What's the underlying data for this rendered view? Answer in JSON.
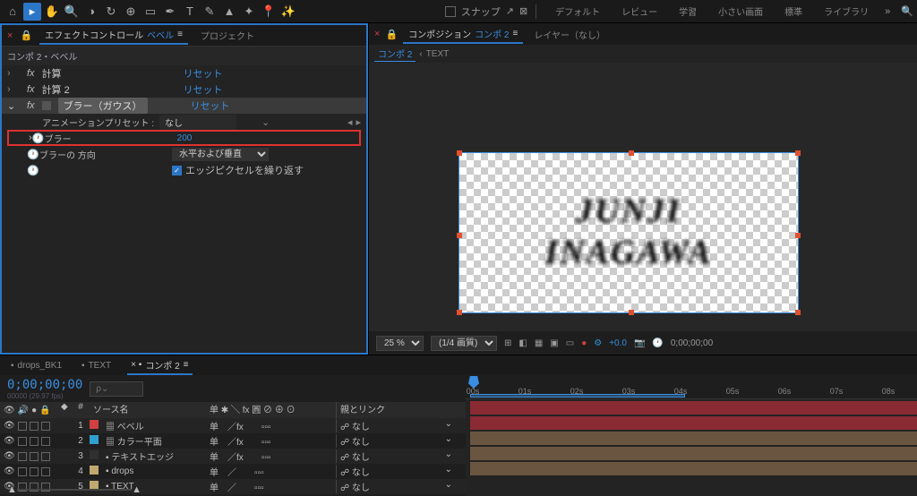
{
  "toolbar": {
    "snap_label": "スナップ"
  },
  "workspaces": [
    "デフォルト",
    "レビュー",
    "学習",
    "小さい画面",
    "標準",
    "ライブラリ"
  ],
  "effect_panel": {
    "tab_effect": "エフェクトコントロール",
    "tab_effect_layer": "ベベル",
    "tab_project": "プロジェクト",
    "breadcrumb": "コンポ 2・ベベル",
    "fx": [
      {
        "name": "計算",
        "reset": "リセット"
      },
      {
        "name": "計算 2",
        "reset": "リセット"
      },
      {
        "name": "ブラー（ガウス）",
        "reset": "リセット",
        "selected": true
      }
    ],
    "preset_label": "アニメーションプリセット :",
    "preset_value": "なし",
    "props": {
      "blur_label": "ブラー",
      "blur_value": "200",
      "dir_label": "ブラーの 方向",
      "dir_value": "水平および垂直",
      "edge_label": "エッジピクセルを繰り返す"
    }
  },
  "comp_panel": {
    "tab_comp": "コンポジション",
    "tab_comp_name": "コンポ 2",
    "tab_layer": "レイヤー（なし）",
    "sub_active": "コンポ 2",
    "sub_text": "TEXT",
    "canvas_line1": "JUNJI",
    "canvas_line2": "INAGAWA"
  },
  "viewer": {
    "zoom": "25 %",
    "quality": "(1/4 画質)",
    "exposure": "+0.0",
    "time": "0;00;00;00"
  },
  "timeline": {
    "tabs": [
      "drops_BK1",
      "TEXT",
      "コンポ 2"
    ],
    "timecode": "0;00;00;00",
    "sub_time": "00000 (29.97 fps)",
    "search_placeholder": "ρ⌄",
    "col_num": "#",
    "col_source": "ソース名",
    "col_switches": "单 ✱ ╲ fx 圓 ⊘ ⊕ ⊙",
    "col_parent": "親とリンク",
    "layers": [
      {
        "n": 1,
        "color": "#d04040",
        "name": "ベベル",
        "sw": "单　／fx",
        "parent": "なし"
      },
      {
        "n": 2,
        "color": "#30a0d0",
        "name": "カラー平面",
        "sw": "单　／fx",
        "parent": "なし"
      },
      {
        "n": 3,
        "color": "#303030",
        "name": "テキストエッジ",
        "sw": "单　／fx",
        "parent": "なし"
      },
      {
        "n": 4,
        "color": "#c0a870",
        "name": "drops",
        "sw": "单　／",
        "parent": "なし"
      },
      {
        "n": 5,
        "color": "#c0a870",
        "name": "TEXT",
        "sw": "单　／",
        "parent": "なし"
      }
    ],
    "ticks": [
      "00s",
      "01s",
      "02s",
      "03s",
      "04s",
      "05s",
      "06s",
      "07s",
      "08s"
    ],
    "bar_colors": [
      "#8a2a32",
      "#8a2a32",
      "#6a5540",
      "#6a5540",
      "#6a5540"
    ]
  }
}
